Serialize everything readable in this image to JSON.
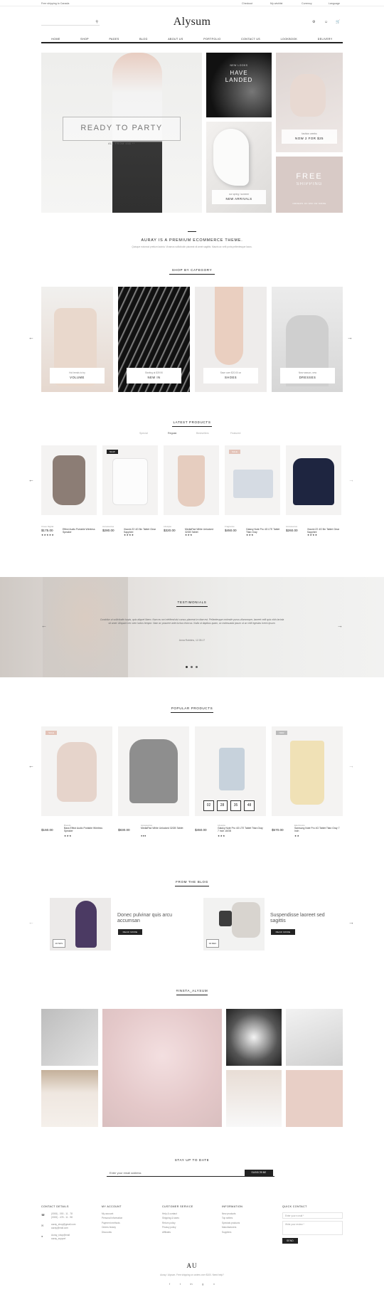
{
  "topbar": {
    "left": "Free shipping to Canada",
    "links": [
      "Checkout",
      "My wishlist",
      "Currency",
      "Language"
    ]
  },
  "header": {
    "logo": "Alysum"
  },
  "nav": {
    "items": [
      "HOME",
      "SHOP",
      "PAGES",
      "BLOG",
      "ABOUT US",
      "PORTFOLIO",
      "CONTACT US",
      "LOOKBOOK",
      "DELIVERY"
    ]
  },
  "hero": {
    "main_title": "READY TO PARTY",
    "main_sub": "ALL FROM 45$ **",
    "new_looks_small": "NEW LOOKS",
    "new_looks_big": "HAVE LANDED",
    "fashion_small": "fashion weeks",
    "fashion_big": "NOW 2 FOR $25",
    "arrivals_small": "our spring / summer",
    "arrivals_big": "NEW ARRIVALS",
    "free_big": "FREE",
    "free_sub": "SHIPPING",
    "free_small": "ORDERS OF $50 OR MORE"
  },
  "intro": {
    "title": "AURAY IS A PREMIUM ECOMMERCE THEME.",
    "text": "Quisque euismod pretium lacinia. Vivamus sollicitudin placerat sit amet sagittis. Mauris ac velit porta pellentesque lacus."
  },
  "categories": {
    "title": "SHOP BY CATEGORY",
    "items": [
      {
        "small": "Hot trends to try",
        "big": "VOLUME"
      },
      {
        "small": "Starting at $39.90",
        "big": "NEW IN"
      },
      {
        "small": "Save over $20.00 on",
        "big": "SHOES"
      },
      {
        "small": "New season, new",
        "big": "DRESSES"
      }
    ]
  },
  "latest": {
    "title": "LATEST PRODUCTS",
    "tabs": [
      "Special",
      "Regular",
      "Bestsellers",
      "Featured"
    ],
    "products": [
      {
        "badge": "",
        "meta": "Crave Digital",
        "name": "Effect Audio Portable Wireless Speaker",
        "price": "$175.00",
        "old": "",
        "stars": "★★★★★"
      },
      {
        "badge": "NEW",
        "meta": "Accessories",
        "name": "Xiaomi Z2 4G 5in Tablet Clear Sapphire",
        "price": "$280.00",
        "old": "",
        "stars": "★★★★"
      },
      {
        "badge": "",
        "meta": "Lifestyle",
        "name": "MediaPad White Unlocked 32GB Tablet",
        "price": "$320.00",
        "old": "",
        "stars": "★★★"
      },
      {
        "badge": "SALE",
        "meta": "Fragrance",
        "name": "Galaxy Note Pro 4G LTE Tablet Titan Gray",
        "price": "$450.00",
        "old": "",
        "stars": "★★★"
      },
      {
        "badge": "",
        "meta": "Accessories",
        "name": "Xiaomi Z2 4G 5in Tablet Clear Sapphire",
        "price": "$260.00",
        "old": "",
        "stars": "★★★★"
      }
    ]
  },
  "testimonials": {
    "title": "TESTIMONIALS",
    "quote": "Curabitur ut sollicitudin turpis, quis aliquet libero. Nam eu orci eleifend dui cursus placerat in vitae est. Pellentesque molestie purus ullamcorper, laoreet velit quis nibh lacinia sit amet. Aliquam nec sem luctus tempor. Nam ac posuere ante luctus rhoncus. Nulla ut dapibus quam, ac malesuada ipsum ut ac velit egestas lorem ipsum.",
    "author": "Anna Robbins, 12.05.17"
  },
  "popular": {
    "title": "POPULAR PRODUCTS",
    "products": [
      {
        "badge": "SALE",
        "meta": "Brands",
        "name": "Bass Effect Audio Portable Wireless Speaker",
        "price": "$160.00",
        "old": "",
        "stars": "★★★"
      },
      {
        "badge": "",
        "meta": "Accessories",
        "name": "MediaPad White Unlocked 32GB Tablet",
        "price": "$830.00",
        "old": "",
        "stars": "●●●"
      },
      {
        "badge": "",
        "meta": "Lifestyle",
        "name": "Galaxy Note Pro 4G LTE Tablet Titan Gray 7 Inch 16GB",
        "price": "$450.00",
        "old": "",
        "stars": "★★★"
      },
      {
        "badge": "NEW",
        "meta": "Electronics",
        "name": "Samsung Note Pro 4G Tablet Titan Gray 7 Inch",
        "price": "$570.00",
        "old": "",
        "stars": "★★"
      }
    ],
    "countdown": [
      "02",
      "28",
      "35",
      "48"
    ]
  },
  "blog": {
    "title": "FROM THE BLOG",
    "posts": [
      {
        "date": "16 NOV",
        "title": "Donec pulvinar quis arcu accumsan",
        "btn": "READ MORE"
      },
      {
        "date": "04 DEC",
        "title": "Suspendisse laoreet sed sagittis",
        "btn": "READ MORE"
      }
    ]
  },
  "insta": {
    "title": "#INSTA_ALYSUM"
  },
  "newsletter": {
    "title": "STAY UP TO DATE",
    "placeholder": "Enter your email address",
    "btn": "SUBSCRIBE"
  },
  "footer": {
    "cols": [
      {
        "title": "CONTACT DETAILS",
        "items": [
          "(0000) - 000 - 11 - 78",
          "(0000) - 478 - 11 - 98",
          "auray_shop@gmail.com",
          "auray@mail.com",
          "Auray_shop@mail",
          "auray_support"
        ]
      },
      {
        "title": "MY ACCOUNT",
        "items": [
          "My account",
          "Personal information",
          "Payment methods",
          "Orders history",
          "Discounts"
        ]
      },
      {
        "title": "CUSTOMER SERVICE",
        "items": [
          "Help & contact",
          "Shipping & taxes",
          "Return policy",
          "Privacy policy",
          "Affiliates"
        ]
      },
      {
        "title": "INFORMATION",
        "items": [
          "New products",
          "Top sellers",
          "Specials products",
          "Manufacturers",
          "Suppliers"
        ]
      }
    ],
    "quick": {
      "title": "QUICK CONTACT",
      "email_ph": "Enter your e-mail *",
      "msg_ph": "Write your review *",
      "btn": "SEND"
    },
    "logo": "AU",
    "copyright": "Auray / Alysum. Free shipping on orders over $100. Need help?",
    "social": [
      "f",
      "t",
      "in",
      "g",
      "v"
    ]
  }
}
